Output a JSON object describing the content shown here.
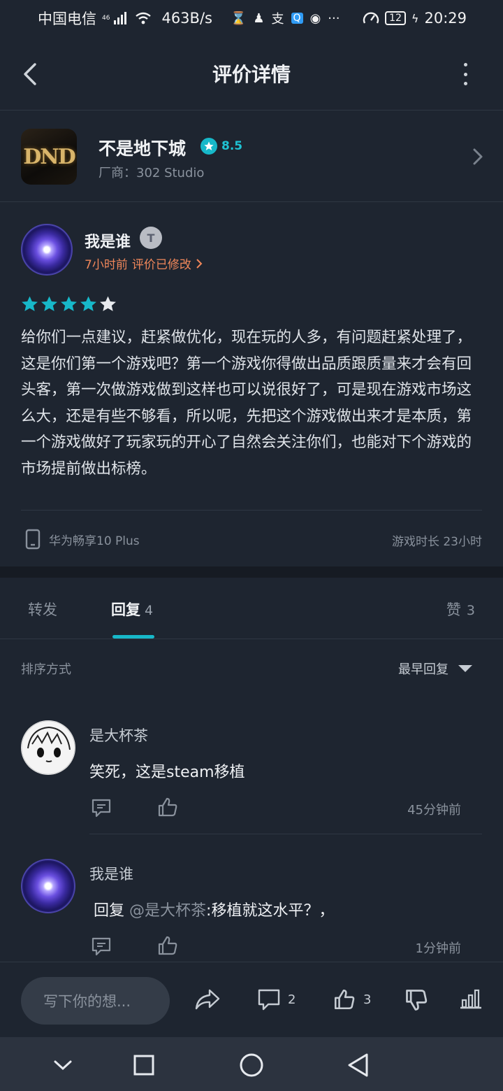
{
  "status_bar": {
    "carrier": "中国电信",
    "network": "46",
    "speed": "463B/s",
    "battery": "12",
    "time": "20:29"
  },
  "header": {
    "title": "评价详情"
  },
  "game": {
    "name": "不是地下城",
    "rating": "8.5",
    "vendor": "厂商：302 Studio",
    "icon_text": "DND"
  },
  "review": {
    "author": "我是谁",
    "badge": "T",
    "time": "7小时前",
    "edited": "评价已修改",
    "stars": 4,
    "text": "给你们一点建议，赶紧做优化，现在玩的人多，有问题赶紧处理了，这是你们第一个游戏吧？第一个游戏你得做出品质跟质量来才会有回头客，第一次做游戏做到这样也可以说很好了，可是现在游戏市场这么大，还是有些不够看，所以呢，先把这个游戏做出来才是本质，第一个游戏做好了玩家玩的开心了自然会关注你们，也能对下个游戏的市场提前做出标榜。",
    "device": "华为畅享10 Plus",
    "playtime": "游戏时长 23小时"
  },
  "tabs": {
    "forward": "转发",
    "reply": "回复",
    "reply_count": "4",
    "like": "赞",
    "like_count": "3"
  },
  "sort": {
    "label": "排序方式",
    "value": "最早回复"
  },
  "comments": [
    {
      "author": "是大杯茶",
      "text": "笑死，这是steam移植",
      "time": "45分钟前"
    },
    {
      "author": "我是谁",
      "prefix": "回复",
      "mention": "@是大杯茶",
      "text": ":移植就这水平？，",
      "time": "1分钟前"
    }
  ],
  "bottom_bar": {
    "placeholder": "写下你的想...",
    "comment_count": "2",
    "like_count": "3"
  },
  "colors": {
    "accent": "#17b8c9",
    "meta_orange": "#f0875a",
    "background": "#1e2530"
  }
}
